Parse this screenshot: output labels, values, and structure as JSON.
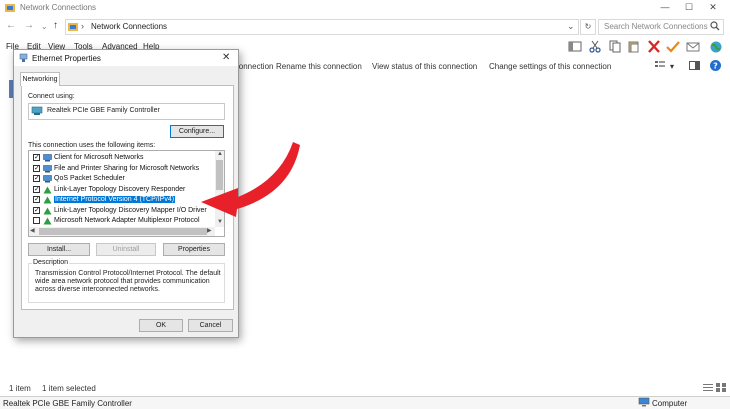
{
  "window": {
    "title": "Network Connections",
    "controls": [
      "—",
      "☐",
      "✕"
    ]
  },
  "navigation": {
    "back": "←",
    "forward": "→",
    "recent": "⌄",
    "up": "↑",
    "path_separator": "›",
    "path": "Network Connections",
    "dropdown": "⌄",
    "refresh": "↻",
    "search_placeholder": "Search Network Connections",
    "search_icon": "search-icon"
  },
  "menu": {
    "items": [
      "File",
      "Edit",
      "View",
      "Tools",
      "Advanced",
      "Help"
    ]
  },
  "command_bar": {
    "items": [
      "Connection",
      "Rename this connection",
      "View status of this connection",
      "Change settings of this connection"
    ],
    "view_arrow": "▾"
  },
  "status": {
    "item_count": "1 item",
    "selected": "1 item selected",
    "details_left": "Realtek PCIe GBE Family Controller",
    "details_right": "Computer"
  },
  "dialog": {
    "title": "Ethernet Properties",
    "close": "✕",
    "tab": "Networking",
    "connect_using_label": "Connect using:",
    "adapter": "Realtek PCIe GBE Family Controller",
    "configure_button": "Configure...",
    "items_label": "This connection uses the following items:",
    "items": [
      {
        "label": "Client for Microsoft Networks",
        "mark": "✓",
        "icon": "network-client-icon"
      },
      {
        "label": "File and Printer Sharing for Microsoft Networks",
        "mark": "✓",
        "icon": "network-client-icon"
      },
      {
        "label": "QoS Packet Scheduler",
        "mark": "✓",
        "icon": "network-client-icon"
      },
      {
        "label": "Link-Layer Topology Discovery Responder",
        "mark": "✓",
        "icon": "protocol-icon"
      },
      {
        "label": "Internet Protocol Version 4 (TCP/IPv4)",
        "mark": "✓",
        "icon": "protocol-icon"
      },
      {
        "label": "Link-Layer Topology Discovery Mapper I/O Driver",
        "mark": "✓",
        "icon": "protocol-icon"
      },
      {
        "label": "Microsoft Network Adapter Multiplexor Protocol",
        "mark": "",
        "icon": "protocol-icon"
      }
    ],
    "selected_index": 4,
    "install_button": "Install...",
    "uninstall_button": "Uninstall",
    "properties_button": "Properties",
    "description_label": "Description",
    "description_text": "Transmission Control Protocol/Internet Protocol. The default wide area network protocol that provides communication across diverse interconnected networks.",
    "ok_button": "OK",
    "cancel_button": "Cancel"
  },
  "annotation": {
    "arrow_color": "#e8202a"
  }
}
